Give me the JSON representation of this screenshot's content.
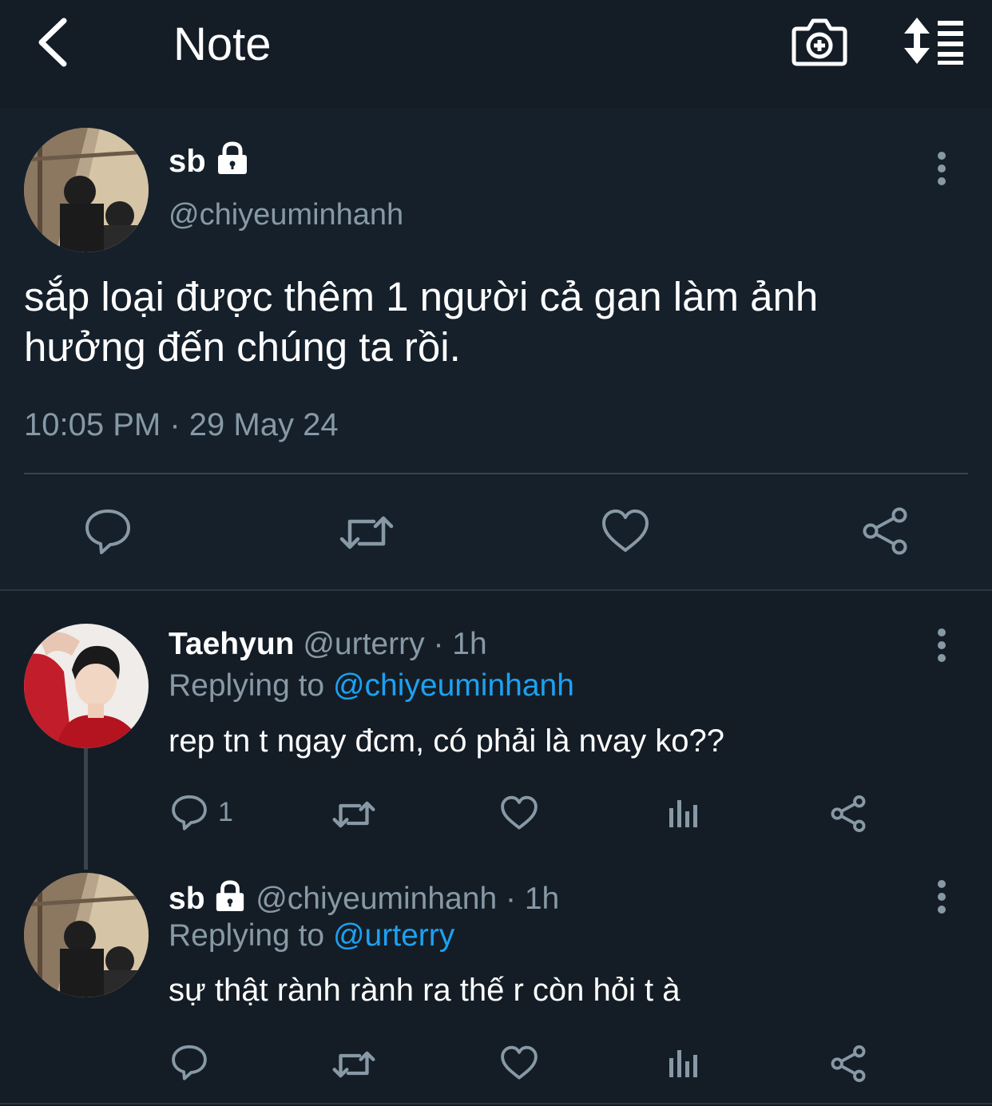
{
  "header": {
    "title": "Note",
    "icons": [
      "back-icon",
      "camera-add-icon",
      "sort-list-icon"
    ]
  },
  "main_tweet": {
    "name": "sb",
    "handle": "@chiyeuminhanh",
    "text_line1": "sắp loại được thêm 1 người cả gan làm ảnh",
    "text_line2": "hưởng đến chúng ta rồi.",
    "time": "10:05 PM",
    "sep": "·",
    "date": "29 May 24",
    "actions": [
      "reply-icon",
      "retweet-icon",
      "like-icon",
      "share-icon"
    ]
  },
  "replies": [
    {
      "name": "Taehyun",
      "handle": "@urterry",
      "sep": "·",
      "age": "1h",
      "replying_label": "Replying to",
      "replying_to": "@chiyeuminhanh",
      "text": "rep tn t ngay đcm, có phải là nvay ko??",
      "reply_count": "1"
    },
    {
      "name": "sb",
      "handle": "@chiyeuminhanh",
      "sep": "·",
      "age": "1h",
      "replying_label": "Replying to",
      "replying_to": "@urterry",
      "text": "sự thật rành rành ra thế r còn hỏi t à"
    }
  ],
  "colors": {
    "background": "#15202b",
    "secondary_text": "#8899a6",
    "mention": "#1da1f2",
    "divider": "#38444d"
  }
}
